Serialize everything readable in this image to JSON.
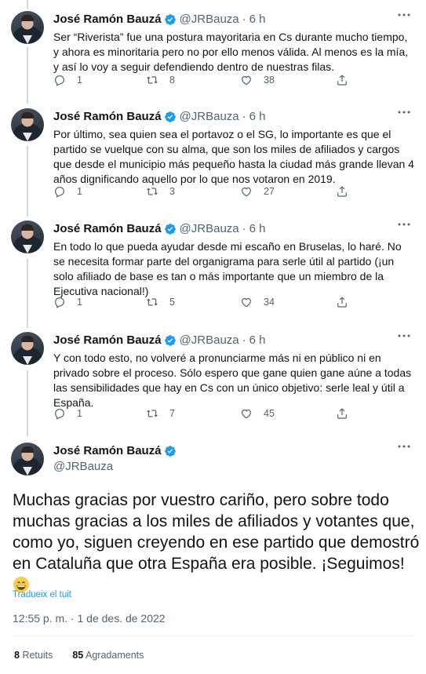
{
  "tweets": [
    {
      "name": "José Ramón Bauzá",
      "handle": "@JRBauza",
      "separator": "·",
      "time": "6 h",
      "text": "Ser “Riverista” fue una postura mayoritaria en Cs durante mucho tiempo, y ahora es minoritaria pero no por ello menos válida. Al menos es la mía, y así lo voy a seguir defendiendo dentro de nuestras filas.",
      "replies": "1",
      "retweets": "8",
      "likes": "38"
    },
    {
      "name": "José Ramón Bauzá",
      "handle": "@JRBauza",
      "separator": "·",
      "time": "6 h",
      "text": "Por último, sea quien sea el portavoz o el SG, lo importante es que el partido se vuelque con su alma, que son los miles de afiliados y cargos que desde el municipio más pequeño hasta la ciudad más grande llevan 4 años dignificando aquello por lo que nos votaron en 2019.",
      "replies": "1",
      "retweets": "3",
      "likes": "27"
    },
    {
      "name": "José Ramón Bauzá",
      "handle": "@JRBauza",
      "separator": "·",
      "time": "6 h",
      "text": "En todo lo que pueda ayudar desde mi escaño en Bruselas, lo haré. No se necesita formar parte del organigrama para serle útil al partido (¡un solo afiliado de base es tan o más importante que un miembro de la Ejecutiva nacional!)",
      "replies": "1",
      "retweets": "5",
      "likes": "34"
    },
    {
      "name": "José Ramón Bauzá",
      "handle": "@JRBauza",
      "separator": "·",
      "time": "6 h",
      "text": "Y con todo esto, no volveré a pronunciarme más ni en público ni en privado sobre el proceso. Sólo espero que gane quien gane aúne a todas las sensibilidades que hay en Cs con un único objetivo: serle leal y útil a España.",
      "replies": "1",
      "retweets": "7",
      "likes": "45"
    }
  ],
  "main_tweet": {
    "name": "José Ramón Bauzá",
    "handle": "@JRBauza",
    "text": "Muchas gracias por vuestro cariño, pero sobre todo muchas gracias a los miles de afiliados y votantes que, como yo, siguen creyendo en ese partido que demostró en Cataluña que otra España era posible. ¡Seguimos!",
    "emoji": "grinning-face",
    "translate": "Tradueix el tuit",
    "timestamp": "12:55 p. m. · 1 de des. de 2022",
    "retweets_count": "8",
    "retweets_label": "Retuits",
    "likes_count": "85",
    "likes_label": "Agradaments"
  },
  "colors": {
    "verified": "#1d9bf0",
    "secondary_text": "#536471",
    "link": "#1d9bf0",
    "thread_line": "#cfd9de"
  }
}
